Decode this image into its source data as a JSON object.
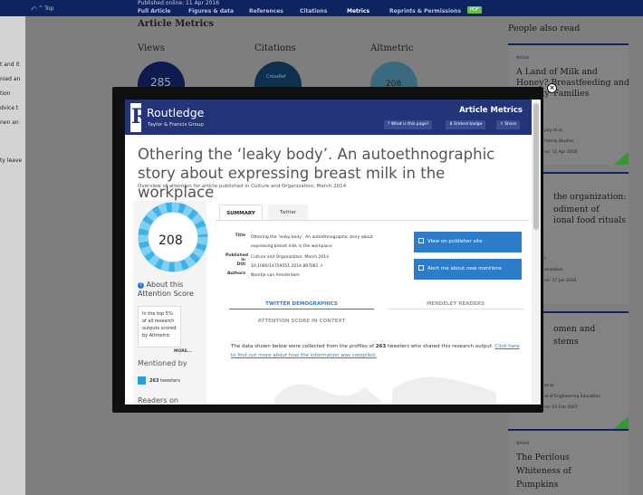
{
  "topbar": {
    "back": "⤺ ^ Top",
    "published": "Published online: 11 Apr 2016",
    "nav": [
      "Full Article",
      "Figures & data",
      "References",
      "Citations",
      "Metrics",
      "Reprints & Permissions"
    ],
    "pdf": "PDF"
  },
  "left_strip": {
    "lines": [
      "t and it",
      "nied an",
      "tion",
      "dvice t",
      "nen an",
      "ty leave"
    ]
  },
  "main": {
    "heading": "Article Metrics",
    "views": "Views",
    "citations": "Citations",
    "altmetric": "Altmetric",
    "views_value": "285",
    "crossref": "CrossRef",
    "altmetric_value": "208"
  },
  "sidebar": {
    "heading": "People also read",
    "cards": [
      {
        "label": "Article",
        "title": "A Land of Milk and Honey? Breastfeeding and Identity",
        "title2": "Families",
        "author": "pay et al.",
        "journal": "Family Studies",
        "date": "ne: 11 Apr 2016"
      },
      {
        "label": "",
        "title": "the organization:",
        "title2": "odiment of",
        "title3": "ional food rituals",
        "author": "r",
        "journal": "anization",
        "date": "ne: 17 Jan 2014"
      },
      {
        "label": "",
        "title": "omen and",
        "title2": "stems",
        "author": "et al.",
        "journal": "al of Engineering Education",
        "date": "ne: 23 Feb 2007"
      },
      {
        "label": "Article",
        "title": "The Perilous",
        "title2": "Whiteness of",
        "title3": "Pumpkins"
      }
    ]
  },
  "modal": {
    "close": "×",
    "brand": "Routledge",
    "brand_sub": "Taylor & Francis Group",
    "logo_letter": "R",
    "header_title": "Article Metrics",
    "buttons": [
      "? What is this page?",
      "⬇ Embed badge",
      "⇪ Share"
    ],
    "article_title": "Othering the ‘leaky body’. An autoethnographic story about expressing breast milk in the workplace",
    "subtitle": "Overview of attention for article published in Culture and Organization, March 2014",
    "score": "208",
    "about_label": "About this Attention Score",
    "top_text": "In the top 5% of all research outputs scored by Altmetric",
    "more": "MORE...",
    "mentioned_by": "Mentioned by",
    "tweeters_count": "263",
    "tweeters_label": "tweeters",
    "readers_on": "Readers on",
    "tabs": [
      "SUMMARY",
      "Twitter"
    ],
    "summary": [
      {
        "key": "Title",
        "value": "Othering the ‘leaky body’. An autoethnographic story about expressing breast milk in the workplace"
      },
      {
        "key": "Published in",
        "value": "Culture and Organization, March 2014"
      },
      {
        "key": "DOI",
        "value": "10.1080/14759551.2014.887081 ↗"
      },
      {
        "key": "Authors",
        "value": "Noortje van Amsterdam"
      }
    ],
    "view_publisher": "View on publisher site",
    "alert": "Alert me about new mentions",
    "subtabs": [
      "TWITTER DEMOGRAPHICS",
      "MENDELEY READERS",
      "ATTENTION SCORE IN CONTEXT"
    ],
    "data_text_a": "The data shown below were collected from the profiles of ",
    "data_count": "263",
    "data_text_b": " tweeters who shared this research output. ",
    "data_link": "Click here to find out more about how the information was compiled."
  },
  "colors": {
    "navy": "#0e2460",
    "header": "#243479",
    "accent": "#2c7cc9",
    "green": "#2d9b2d"
  }
}
